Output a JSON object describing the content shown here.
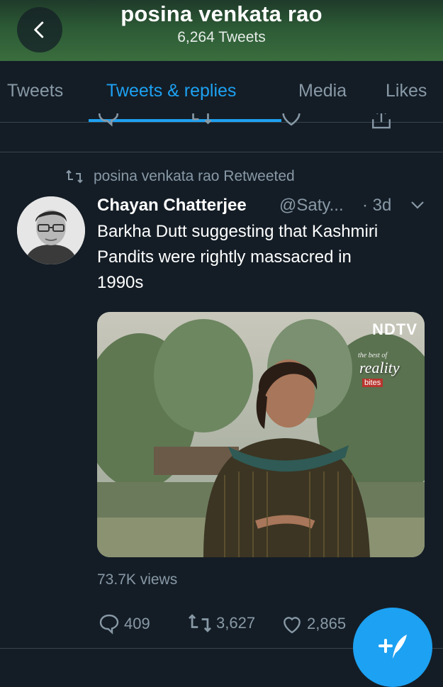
{
  "header": {
    "title": "posina venkata rao",
    "subtitle": "6,264 Tweets"
  },
  "tabs": [
    {
      "label": "Tweets",
      "active": false
    },
    {
      "label": "Tweets & replies",
      "active": true
    },
    {
      "label": "Media",
      "active": false
    },
    {
      "label": "Likes",
      "active": false
    }
  ],
  "tweet": {
    "retweet_context": "posina venkata rao Retweeted",
    "author_name": "Chayan Chatterjee",
    "author_handle": "@Saty...",
    "time": "· 3d",
    "text": "Barkha Dutt suggesting that Kashmiri Pandits were rightly massacred in 1990s",
    "media_watermark": "NDTV",
    "media_overlay_top": "the best of",
    "media_overlay_mid": "reality",
    "media_overlay_bottom": "bites",
    "views": "73.7K views",
    "replies": "409",
    "retweets": "3,627",
    "likes": "2,865"
  },
  "colors": {
    "accent": "#1da1f2",
    "background": "#141d26",
    "muted": "#8899a6",
    "divider": "#38444d"
  },
  "icons": [
    "back-arrow-icon",
    "reply-icon",
    "retweet-icon",
    "like-icon",
    "share-icon",
    "chevron-down-icon",
    "compose-tweet-icon"
  ]
}
